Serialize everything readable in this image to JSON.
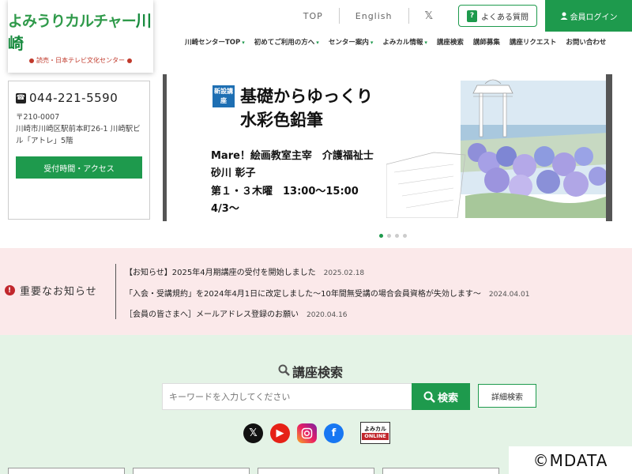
{
  "logo": {
    "main": "よみうりカルチャー",
    "place": "川崎",
    "sub": "読売・日本テレビ文化センター"
  },
  "topbar": {
    "top": "TOP",
    "english": "English",
    "faq": "よくある質問",
    "login": "会員ログイン",
    "faq_icon": "?"
  },
  "nav": [
    {
      "label": "川崎センターTOP",
      "caret": true
    },
    {
      "label": "初めてご利用の方へ",
      "caret": true
    },
    {
      "label": "センター案内",
      "caret": true
    },
    {
      "label": "よみカル情報",
      "caret": true
    },
    {
      "label": "講座検索",
      "caret": false
    },
    {
      "label": "講師募集",
      "caret": false
    },
    {
      "label": "講座リクエスト",
      "caret": false
    },
    {
      "label": "お問い合わせ",
      "caret": false
    }
  ],
  "contact": {
    "phone": "044-221-5590",
    "postal": "〒210-0007",
    "address": "川崎市川崎区駅前本町26-1 川崎駅ビル「アトレ」5階",
    "access": "受付時間・アクセス"
  },
  "banner": {
    "badge": "新設講座",
    "title1": "基礎からゆっくり",
    "title2": "水彩色鉛筆",
    "line1": "Mare！絵画教室主宰　介護福祉士",
    "line2": "砂川 彰子",
    "line3": "第１・３木曜　13:00〜15:00",
    "line4": "4/3〜"
  },
  "notices": {
    "heading": "重要なお知らせ",
    "items": [
      {
        "text": "【お知らせ】2025年4月期講座の受付を開始しました",
        "date": "2025.02.18"
      },
      {
        "text": "「入会・受講規約」を2024年4月1日に改定しました〜10年間無受講の場合会員資格が失効します〜",
        "date": "2024.04.01"
      },
      {
        "text": "［会員の皆さまへ］メールアドレス登録のお願い",
        "date": "2020.04.16"
      }
    ]
  },
  "search": {
    "title": "講座検索",
    "placeholder": "キーワードを入力してください",
    "button": "検索",
    "advanced": "詳細検索"
  },
  "social": {
    "yomi_top": "よみカル",
    "yomi_bottom": "ONLINE"
  },
  "watermark": "©MDATA",
  "colors": {
    "accent": "#1e9a4d",
    "notice_bg": "#fbe9ea",
    "search_bg": "#e4f3e6",
    "warn": "#c1272d"
  }
}
